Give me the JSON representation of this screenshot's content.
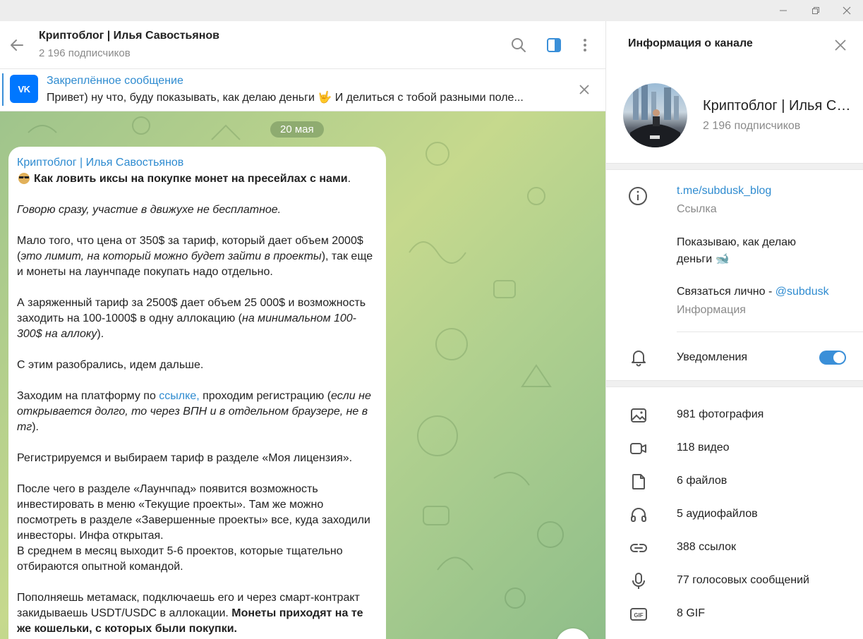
{
  "window": {
    "minimize_icon": "minimize-icon",
    "restore_icon": "restore-icon",
    "close_icon": "close-icon"
  },
  "chat": {
    "title": "Криптоблог | Илья Савостьянов",
    "subscribers": "2 196 подписчиков",
    "pinned": {
      "logo": "VK",
      "title": "Закреплённое сообщение",
      "text": "Привет) ну что, буду показывать, как делаю деньги 🤟  И делиться с тобой разными поле..."
    },
    "date_chip": "20 мая",
    "message": {
      "author": "Криптоблог | Илья Савостьянов",
      "heading": "Как ловить иксы на покупке монет на пресейлах с нами",
      "p1": "Говорю сразу, участие в движухе не бесплатное.",
      "p2_a": "Мало того, что цена от 350$ за тариф, который дает объем 2000$ (",
      "p2_i": "это лимит, на который можно будет зайти в проекты",
      "p2_b": "), так еще и монеты на лаунчпаде покупать надо отдельно.",
      "p3_a": "А заряженный тариф за 2500$ дает объем 25 000$ и возможность заходить на 100-1000$ в одну аллокацию (",
      "p3_i": "на минимальном 100-300$ на аллоку",
      "p3_b": ").",
      "p4": "С этим разобрались, идем дальше.",
      "p5_a": "Заходим на платформу по ",
      "p5_link": "ссылке,",
      "p5_b": " проходим регистрацию (",
      "p5_i": "если не открывается долго, то через ВПН и в отдельном браузере, не в тг",
      "p5_c": ").",
      "p6": "Регистрируемся и выбираем тариф в разделе «Моя лицензия».",
      "p7_1": "После чего в разделе «Лаунчпад» появится возможность инвестировать в меню «Текущие проекты». Там же можно посмотреть в разделе «Завершенные проекты» все, куда заходили инвесторы. Инфа открытая.",
      "p7_2": "В среднем в месяц выходит 5-6 проектов, которые тщательно отбираются опытной командой.",
      "p8_a": "Пополняешь метамаск, подключаешь его и через смарт-контракт закидываешь USDT/USDC в аллокации. ",
      "p8_b": "Монеты приходят на те же кошельки, с которых были покупки."
    }
  },
  "panel": {
    "header": "Информация о канале",
    "channel_name": "Криптоблог | Илья Савостьянов",
    "subscribers": "2 196 подписчиков",
    "link": "t.me/subdusk_blog",
    "link_caption": "Ссылка",
    "description": "Показываю, как делаю деньги 🐋",
    "contact_prefix": "Связаться лично - ",
    "contact_handle": "@subdusk",
    "contact_caption": "Информация",
    "notifications_label": "Уведомления",
    "notifications_on": true,
    "media": [
      {
        "icon": "photo-icon",
        "label": "981 фотография"
      },
      {
        "icon": "video-icon",
        "label": "118 видео"
      },
      {
        "icon": "file-icon",
        "label": "6 файлов"
      },
      {
        "icon": "headphones-icon",
        "label": "5 аудиофайлов"
      },
      {
        "icon": "link-icon",
        "label": "388 ссылок"
      },
      {
        "icon": "mic-icon",
        "label": "77 голосовых сообщений"
      },
      {
        "icon": "gif-icon",
        "label": "8 GIF"
      }
    ]
  },
  "colors": {
    "accent": "#3a8fd8",
    "link": "#2e8bd0",
    "vk": "#0077ff"
  }
}
